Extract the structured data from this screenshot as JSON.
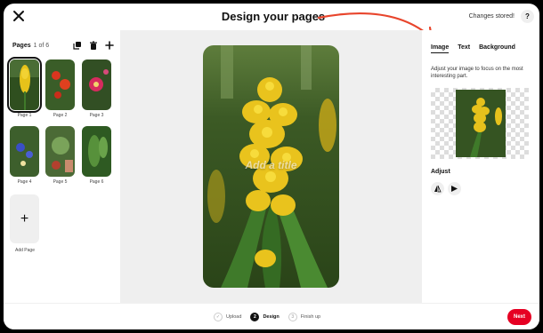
{
  "header": {
    "title": "Design your pages",
    "status": "Changes stored!",
    "help_label": "?",
    "close_icon": "close-icon"
  },
  "left_panel": {
    "heading": "Pages",
    "count": "1 of 6",
    "toolbar": [
      "duplicate-icon",
      "trash-icon",
      "plus-icon"
    ],
    "pages": [
      {
        "label": "Page 1",
        "selected": true
      },
      {
        "label": "Page 2",
        "selected": false
      },
      {
        "label": "Page 3",
        "selected": false
      },
      {
        "label": "Page 4",
        "selected": false
      },
      {
        "label": "Page 5",
        "selected": false
      },
      {
        "label": "Page 6",
        "selected": false
      }
    ],
    "add_page_symbol": "+",
    "add_page_label": "Add Page"
  },
  "canvas": {
    "title_placeholder": "Add a title"
  },
  "right_panel": {
    "tabs": [
      {
        "label": "Image",
        "active": true
      },
      {
        "label": "Text",
        "active": false
      },
      {
        "label": "Background",
        "active": false
      }
    ],
    "description": "Adjust your image to focus on the most interesting part.",
    "adjust_label": "Adjust",
    "adjust_buttons": [
      "flip-icon",
      "rotate-icon"
    ]
  },
  "footer": {
    "steps": [
      {
        "number": "✓",
        "label": "Upload",
        "state": "done"
      },
      {
        "number": "2",
        "label": "Design",
        "state": "active"
      },
      {
        "number": "3",
        "label": "Finish up",
        "state": "todo"
      }
    ],
    "next_label": "Next"
  },
  "colors": {
    "accent": "#e60023",
    "annotation_arrow": "#e8452c"
  }
}
